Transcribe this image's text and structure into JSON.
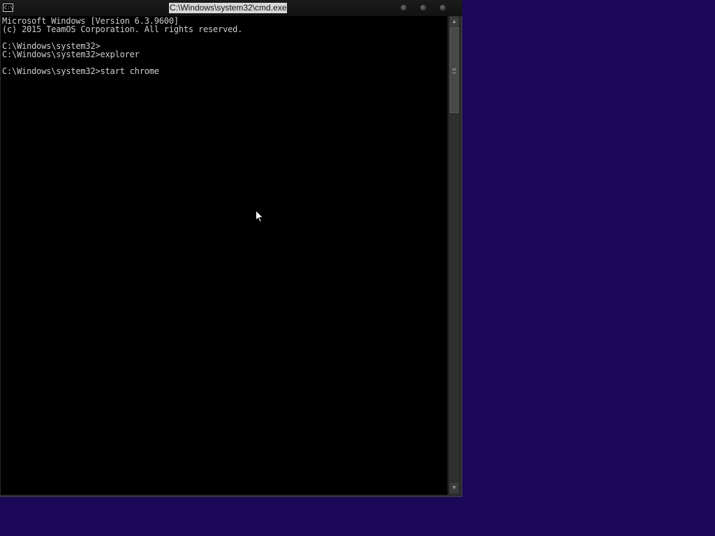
{
  "window": {
    "title": "C:\\Windows\\system32\\cmd.exe",
    "icon": "console-app-icon",
    "icon_glyph": "C:\\."
  },
  "console": {
    "lines": [
      "Microsoft Windows [Version 6.3.9600]",
      "(c) 2015 TeamOS Corporation. All rights reserved.",
      "",
      "C:\\Windows\\system32>",
      "C:\\Windows\\system32>explorer",
      "",
      "C:\\Windows\\system32>start chrome"
    ]
  },
  "scrollbar": {
    "up_glyph": "▲",
    "down_glyph": "▼"
  },
  "colors": {
    "desktop_background": "#1b0858",
    "console_background": "#000000",
    "console_text": "#cfcfcf"
  }
}
